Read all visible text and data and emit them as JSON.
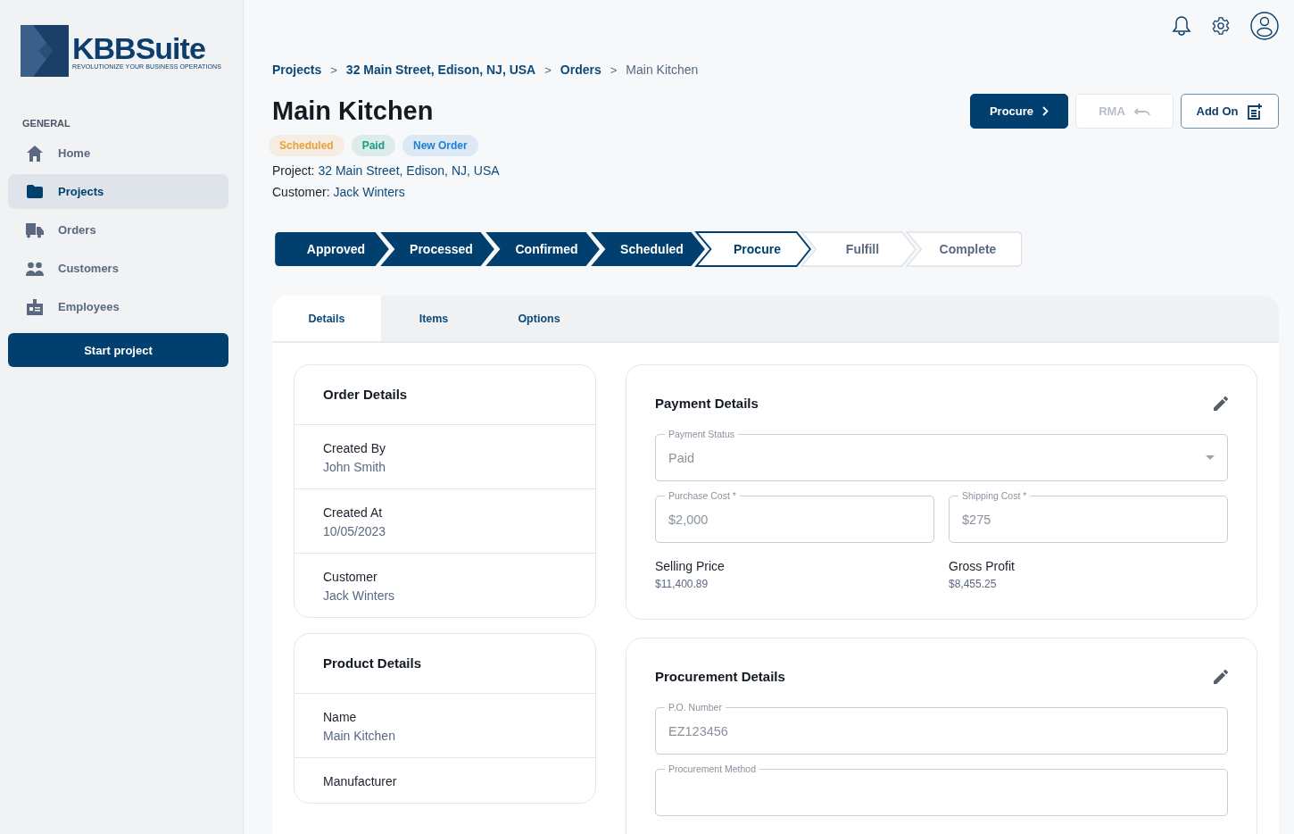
{
  "logo": {
    "name": "KBBSuite",
    "tagline": "REVOLUTIONIZE YOUR BUSINESS OPERATIONS"
  },
  "sidebar": {
    "section": "GENERAL",
    "items": [
      {
        "label": "Home",
        "selected": false
      },
      {
        "label": "Projects",
        "selected": true
      },
      {
        "label": "Orders",
        "selected": false
      },
      {
        "label": "Customers",
        "selected": false
      },
      {
        "label": "Employees",
        "selected": false
      }
    ],
    "button": "Start project"
  },
  "breadcrumb": [
    {
      "label": "Projects",
      "link": true
    },
    {
      "label": "32 Main Street, Edison, NJ, USA",
      "link": true
    },
    {
      "label": "Orders",
      "link": true
    },
    {
      "label": "Main Kitchen",
      "link": false
    }
  ],
  "breadcrumb_separator": ">",
  "title": "Main Kitchen",
  "badges": [
    {
      "label": "Scheduled",
      "color": "#e8a13c"
    },
    {
      "label": "Paid",
      "color": "#1a9a7e"
    },
    {
      "label": "New Order",
      "color": "#1f7fd6"
    }
  ],
  "info": [
    {
      "label": "Project:",
      "value": "32 Main Street, Edison, NJ, USA"
    },
    {
      "label": "Customer:",
      "value": "Jack Winters"
    }
  ],
  "actions": [
    {
      "label": "Procure",
      "kind": "primary",
      "disabled": false
    },
    {
      "label": "RMA",
      "kind": "undo",
      "disabled": true
    },
    {
      "label": "Add On",
      "kind": "addon",
      "disabled": false
    }
  ],
  "steps": [
    {
      "label": "Approved",
      "kind": "done"
    },
    {
      "label": "Processed",
      "kind": "done"
    },
    {
      "label": "Confirmed",
      "kind": "done"
    },
    {
      "label": "Scheduled",
      "kind": "done"
    },
    {
      "label": "Procure",
      "kind": "current"
    },
    {
      "label": "Fulfill",
      "kind": "pending"
    },
    {
      "label": "Complete",
      "kind": "pending"
    }
  ],
  "tabs": [
    {
      "label": "Details",
      "selected": true
    },
    {
      "label": "Items",
      "selected": false
    },
    {
      "label": "Options",
      "selected": false
    }
  ],
  "left_cards": [
    {
      "title": "Order Details",
      "rows": [
        {
          "label": "Created By",
          "value": "John Smith"
        },
        {
          "label": "Created At",
          "value": "10/05/2023"
        },
        {
          "label": "Customer",
          "value": "Jack Winters"
        }
      ]
    },
    {
      "title": "Product Details",
      "rows": [
        {
          "label": "Name",
          "value": "Main Kitchen"
        },
        {
          "label": "Manufacturer"
        }
      ]
    }
  ],
  "payment": {
    "title": "Payment Details",
    "status": {
      "label": "Payment Status",
      "value": "Paid"
    },
    "fields": [
      {
        "label": "Purchase Cost *",
        "value": "$2,000"
      },
      {
        "label": "Shipping Cost *",
        "value": "$275"
      }
    ],
    "stats": [
      {
        "label": "Selling Price",
        "value": "$11,400.89"
      },
      {
        "label": "Gross Profit",
        "value": "$8,455.25"
      }
    ]
  },
  "procurement": {
    "title": "Procurement Details",
    "fields": [
      {
        "label": "P.O. Number",
        "value": "EZ123456"
      },
      {
        "label": "Procurement Method"
      }
    ]
  }
}
